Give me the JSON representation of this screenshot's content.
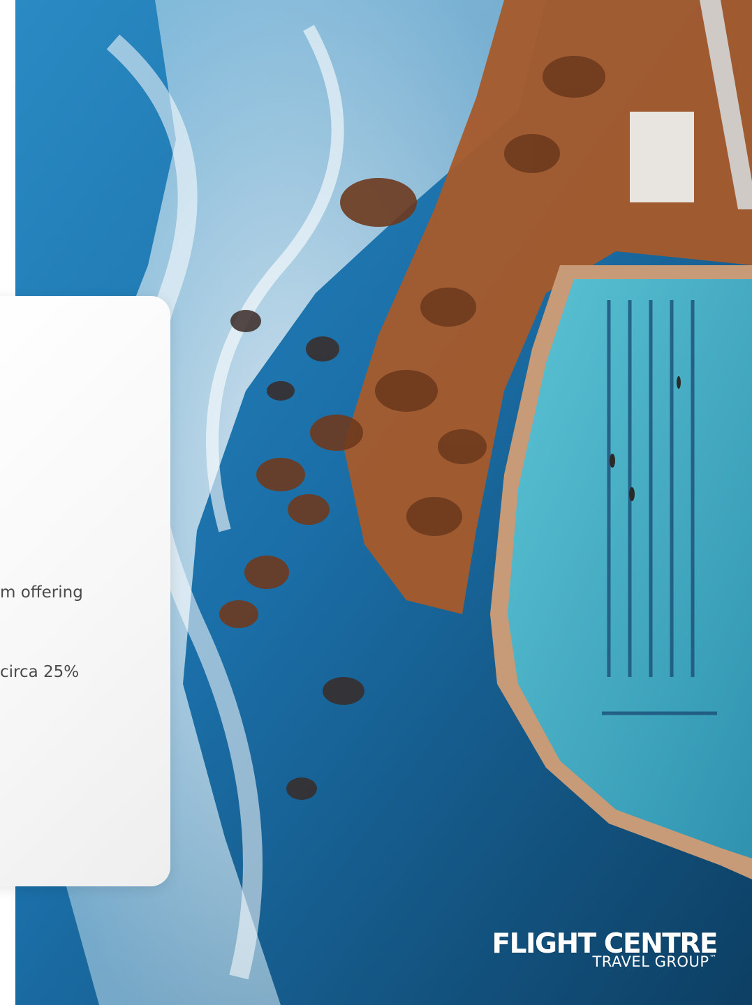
{
  "slide": {
    "card": {
      "lines": [
        "m offering",
        "circa 25%"
      ]
    },
    "logo": {
      "name": "FLIGHT CENTRE",
      "subtitle": "TRAVEL GROUP",
      "trademark": "™",
      "color": "#ffffff"
    },
    "photo": {
      "subject_colors": {
        "ocean": "#1e78b4",
        "foam": "#ffffff",
        "rock": "#b8642c",
        "pool": "#4fb2c8"
      }
    }
  }
}
